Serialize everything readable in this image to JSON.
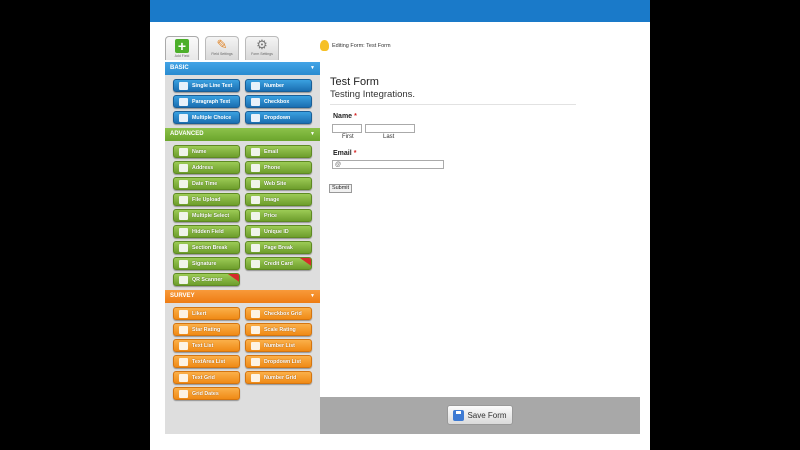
{
  "toolbar": {
    "tabs": [
      {
        "label": "Add Field",
        "icon": "plus-icon"
      },
      {
        "label": "Field Settings",
        "icon": "pencil-icon"
      },
      {
        "label": "Form Settings",
        "icon": "gear-icon"
      }
    ],
    "editing": "Editing Form: Test Form"
  },
  "sidebar": {
    "basic": {
      "title": "BASIC",
      "fields": [
        "Single Line Text",
        "Number",
        "Paragraph Text",
        "Checkbox",
        "Multiple Choice",
        "Dropdown"
      ]
    },
    "advanced": {
      "title": "ADVANCED",
      "fields": [
        "Name",
        "Email",
        "Address",
        "Phone",
        "Date Time",
        "Web Site",
        "File Upload",
        "Image",
        "Multiple Select",
        "Price",
        "Hidden Field",
        "Unique ID",
        "Section Break",
        "Page Break",
        "Signature",
        "Credit Card",
        "QR Scanner"
      ]
    },
    "survey": {
      "title": "SURVEY",
      "fields": [
        "Likert",
        "Checkbox Grid",
        "Star Rating",
        "Scale Rating",
        "Text List",
        "Number List",
        "TextArea List",
        "Dropdown List",
        "Text Grid",
        "Number Grid",
        "Grid Dates"
      ]
    }
  },
  "form": {
    "title": "Test Form",
    "description": "Testing Integrations.",
    "name_label": "Name",
    "required_mark": "*",
    "first": "First",
    "last": "Last",
    "email_label": "Email",
    "email_prefix": "@",
    "submit": "Submit"
  },
  "footer": {
    "save": "Save Form"
  },
  "colors": {
    "topbar": "#1a7ac9",
    "basic": "#2a8bd0",
    "advanced": "#6ba52c",
    "survey": "#ee7c13"
  }
}
